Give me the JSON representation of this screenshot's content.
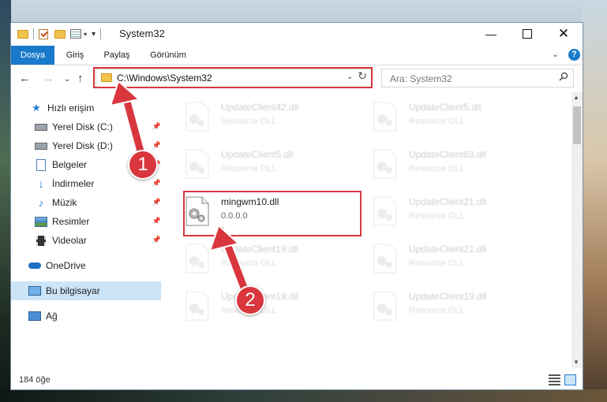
{
  "window": {
    "title": "System32"
  },
  "ribbon": {
    "tabs": [
      "Dosya",
      "Giriş",
      "Paylaş",
      "Görünüm"
    ]
  },
  "address": {
    "path": "C:\\Windows\\System32"
  },
  "search": {
    "placeholder": "Ara: System32"
  },
  "sidebar": {
    "items": [
      {
        "label": "Hızlı erişim",
        "icon": "star-icon"
      },
      {
        "label": "Yerel Disk (C:)",
        "icon": "drive-icon",
        "pinned": true
      },
      {
        "label": "Yerel Disk (D:)",
        "icon": "drive-icon",
        "pinned": true
      },
      {
        "label": "Belgeler",
        "icon": "document-icon",
        "pinned": true
      },
      {
        "label": "İndirmeler",
        "icon": "download-icon",
        "pinned": true
      },
      {
        "label": "Müzik",
        "icon": "music-icon",
        "pinned": true
      },
      {
        "label": "Resimler",
        "icon": "pictures-icon",
        "pinned": true
      },
      {
        "label": "Videolar",
        "icon": "video-icon",
        "pinned": true
      },
      {
        "label": "OneDrive",
        "icon": "cloud-icon"
      },
      {
        "label": "Bu bilgisayar",
        "icon": "computer-icon",
        "selected": true
      },
      {
        "label": "Ağ",
        "icon": "network-icon"
      }
    ]
  },
  "files": [
    {
      "name": "UpdateClient42.dll",
      "type": "Resource DLL"
    },
    {
      "name": "UpdateClient5.dll",
      "type": "Resource DLL"
    },
    {
      "name": "UpdateClient5.dll",
      "type": "Resource DLL"
    },
    {
      "name": "UpdateClient63.dll",
      "type": "Resource DLL"
    },
    {
      "name": "mingwm10.dll",
      "type": "0.0.0.0",
      "extra": "-"
    },
    {
      "name": "UpdateClient21.dll",
      "type": "Resource DLL"
    },
    {
      "name": "UpdateClient19.dll",
      "type": "Resource DLL"
    },
    {
      "name": "UpdateClient21.dll",
      "type": "Resource DLL"
    },
    {
      "name": "UpdateClient19.dll",
      "type": "Resource DLL"
    },
    {
      "name": "UpdateClient19.dll",
      "type": "Resource DLL"
    }
  ],
  "status": {
    "count": "184 öğe"
  },
  "callouts": [
    "1",
    "2"
  ],
  "colors": {
    "accent": "#1979ca",
    "highlight": "#d9363e"
  }
}
